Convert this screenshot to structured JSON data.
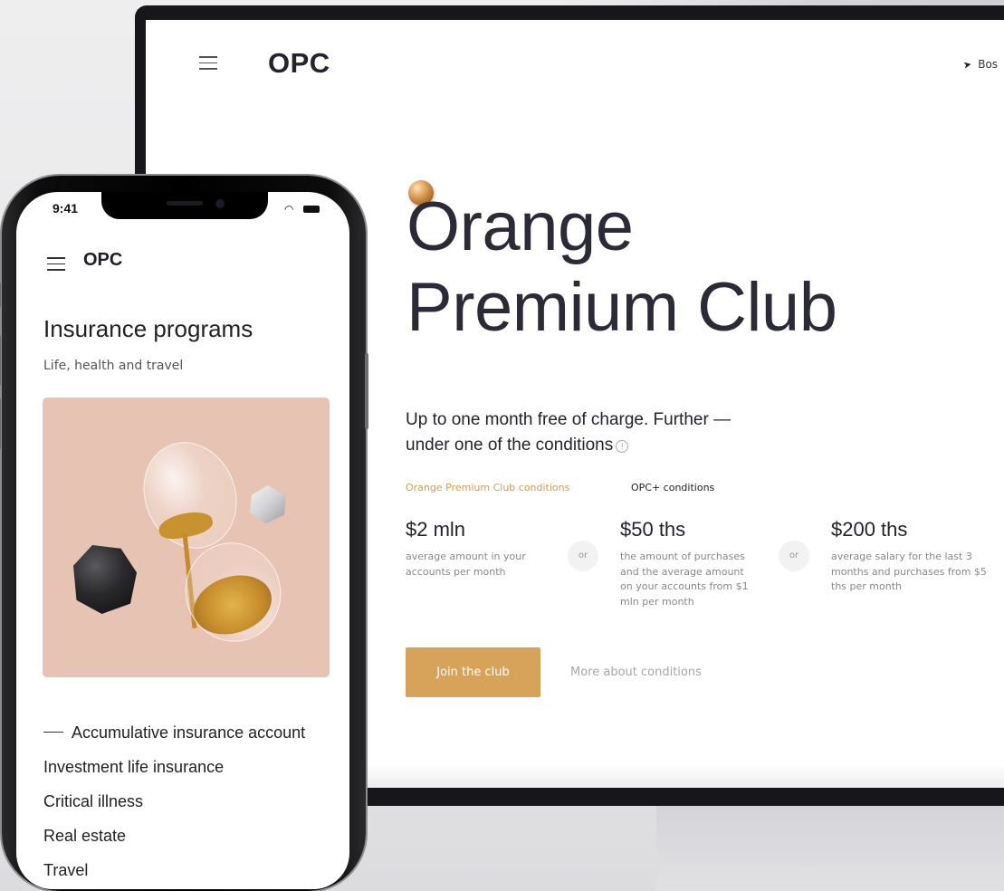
{
  "desktop": {
    "logo": "OPC",
    "location": "Bos",
    "hero_line1": "Orange",
    "hero_line2": "Premium Club",
    "subtitle_line1": "Up to one month free of charge. Further —",
    "subtitle_line2": "under one of the conditions",
    "tabs": [
      "Orange Premium Club conditions",
      "OPC+ conditions"
    ],
    "stats": [
      {
        "value": "$2 mln",
        "desc_lines": [
          "average amount in your",
          "accounts per month"
        ]
      },
      {
        "value": "$50 ths",
        "desc_lines": [
          "the amount of purchases",
          "and the average amount",
          "on your accounts from $1",
          "mln per month"
        ]
      },
      {
        "value": "$200 ths",
        "desc_lines": [
          "average salary for the last 3",
          "months and purchases from $5",
          "ths per month"
        ]
      }
    ],
    "or_label": "or",
    "join_button": "Join the club",
    "more_link": "More about conditions"
  },
  "phone": {
    "time": "9:41",
    "logo": "OPC",
    "title": "Insurance programs",
    "subtitle": "Life, health and travel",
    "list": [
      "Accumulative insurance account",
      "Investment life insurance",
      "Critical illness",
      "Real estate",
      "Travel"
    ]
  },
  "colors": {
    "accent": "#d7a35b",
    "tab_active": "#d39a52",
    "heading": "#2b2b37",
    "image_bg": "#e7c3b3"
  }
}
